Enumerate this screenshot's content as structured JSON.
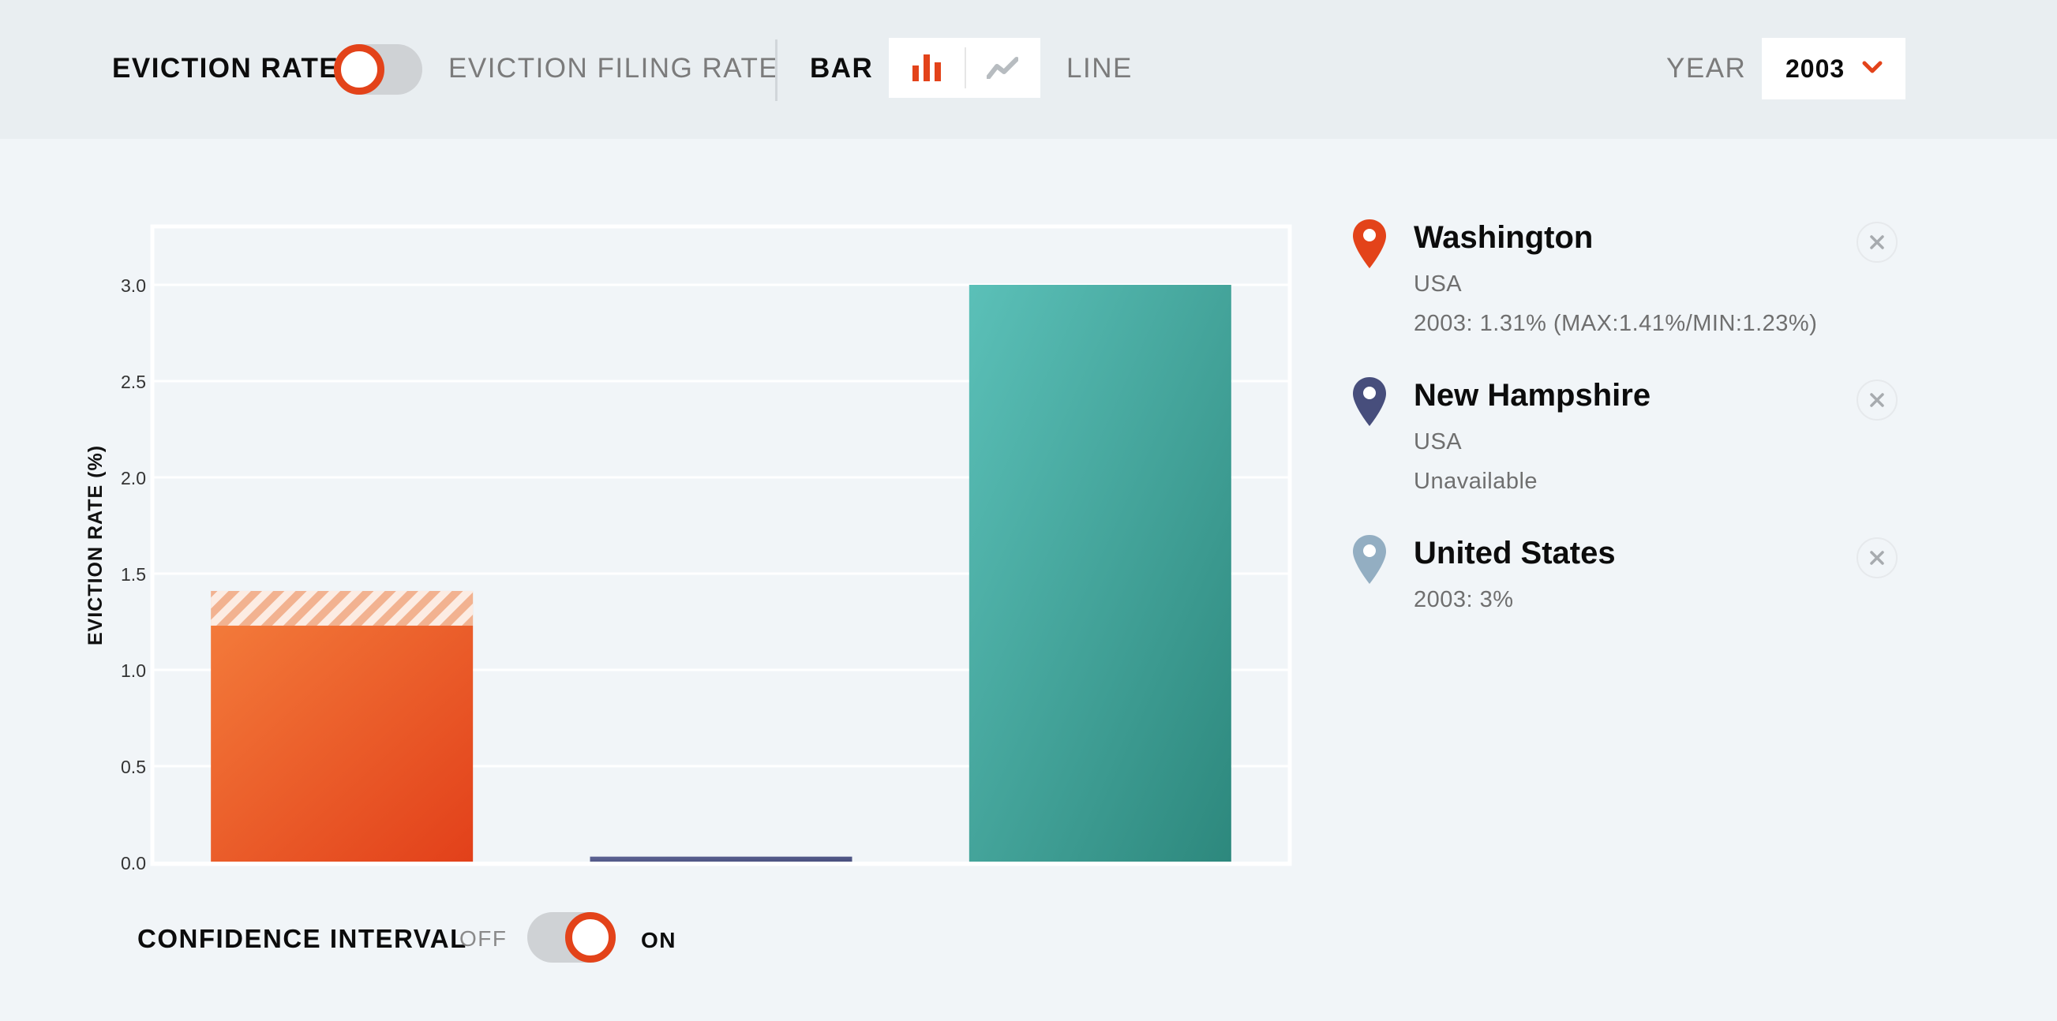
{
  "controls": {
    "metric_left_label": "EVICTION RATE",
    "metric_right_label": "EVICTION FILING RATE",
    "charttype_bar_label": "BAR",
    "charttype_line_label": "LINE",
    "year_label": "YEAR",
    "year_value": "2003"
  },
  "confidence_interval": {
    "label": "CONFIDENCE INTERVAL",
    "off_label": "OFF",
    "on_label": "ON",
    "enabled": true
  },
  "legend": [
    {
      "name": "Washington",
      "region": "USA",
      "detail": "2003: 1.31% (MAX:1.41%/MIN:1.23%)",
      "color": "#e3431a"
    },
    {
      "name": "New Hampshire",
      "region": "USA",
      "detail": "Unavailable",
      "color": "#474e7c"
    },
    {
      "name": "United States",
      "region": "",
      "detail": "2003: 3%",
      "color": "#93aec2"
    }
  ],
  "chart_data": {
    "type": "bar",
    "title": "",
    "xlabel": "",
    "ylabel": "EVICTION RATE (%)",
    "ylim": [
      0,
      3.3
    ],
    "yticks": [
      "0.0",
      "0.5",
      "1.0",
      "1.5",
      "2.0",
      "2.5",
      "3.0"
    ],
    "grid": true,
    "categories": [
      "Washington",
      "New Hampshire",
      "United States"
    ],
    "values": [
      1.31,
      0.03,
      3.0
    ],
    "ci_min": [
      1.23,
      null,
      null
    ],
    "ci_max": [
      1.41,
      null,
      null
    ],
    "colors": [
      [
        "#f37a3a",
        "#e2401a"
      ],
      [
        "#5e6494",
        "#474e7c"
      ],
      [
        "#5bc0b8",
        "#2d887d"
      ]
    ]
  }
}
